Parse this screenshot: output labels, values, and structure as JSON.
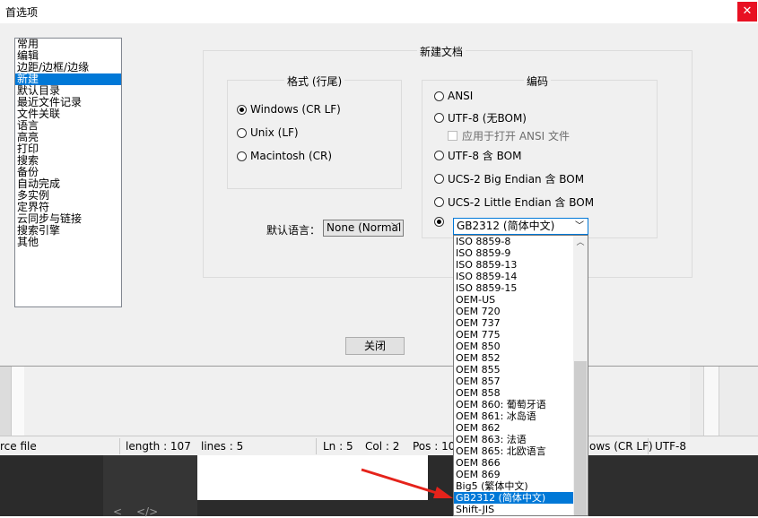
{
  "window": {
    "title": "首选项",
    "close_icon": "✕"
  },
  "categories": [
    "常用",
    "编辑",
    "边距/边框/边缘",
    "新建",
    "默认目录",
    "最近文件记录",
    "文件关联",
    "语言",
    "高亮",
    "打印",
    "搜索",
    "备份",
    "自动完成",
    "多实例",
    "定界符",
    "云同步与链接",
    "搜索引擎",
    "其他"
  ],
  "selected_category": "新建",
  "new_doc": {
    "group_title": "新建文档",
    "format": {
      "title": "格式 (行尾)",
      "options": [
        "Windows (CR LF)",
        "Unix (LF)",
        "Macintosh (CR)"
      ],
      "selected": "Windows (CR LF)"
    },
    "default_language_label": "默认语言：",
    "default_language_value": "None (Normal",
    "encoding": {
      "title": "编码",
      "options": [
        "ANSI",
        "UTF-8 (无BOM)",
        "UTF-8 含 BOM",
        "UCS-2 Big Endian 含 BOM",
        "UCS-2 Little Endian 含 BOM"
      ],
      "apply_checkbox": "应用于打开 ANSI 文件",
      "selected_combo_value": "GB2312 (简体中文)"
    }
  },
  "dropdown_items": [
    "ISO 8859-8",
    "ISO 8859-9",
    "ISO 8859-13",
    "ISO 8859-14",
    "ISO 8859-15",
    "OEM-US",
    "OEM 720",
    "OEM 737",
    "OEM 775",
    "OEM 850",
    "OEM 852",
    "OEM 855",
    "OEM 857",
    "OEM 858",
    "OEM 860: 葡萄牙语",
    "OEM 861: 冰岛语",
    "OEM 862",
    "OEM 863: 法语",
    "OEM 865: 北欧语言",
    "OEM 866",
    "OEM 869",
    "Big5 (繁体中文)",
    "GB2312 (简体中文)",
    "Shift-JIS"
  ],
  "dropdown_selected": "GB2312 (简体中文)",
  "close_button": "关闭",
  "statusbar": {
    "file_type": "rce file",
    "length": "length : 107",
    "lines": "lines : 5",
    "ln": "Ln : 5",
    "col": "Col : 2",
    "pos": "Pos : 10",
    "eol": "ows (CR LF)",
    "encoding": "UTF-8"
  },
  "bottom_icons": {
    "back": "<",
    "code": "</>"
  },
  "colors": {
    "accent": "#0078d7",
    "close_red": "#e81123",
    "annotation_arrow": "#e5231b"
  }
}
